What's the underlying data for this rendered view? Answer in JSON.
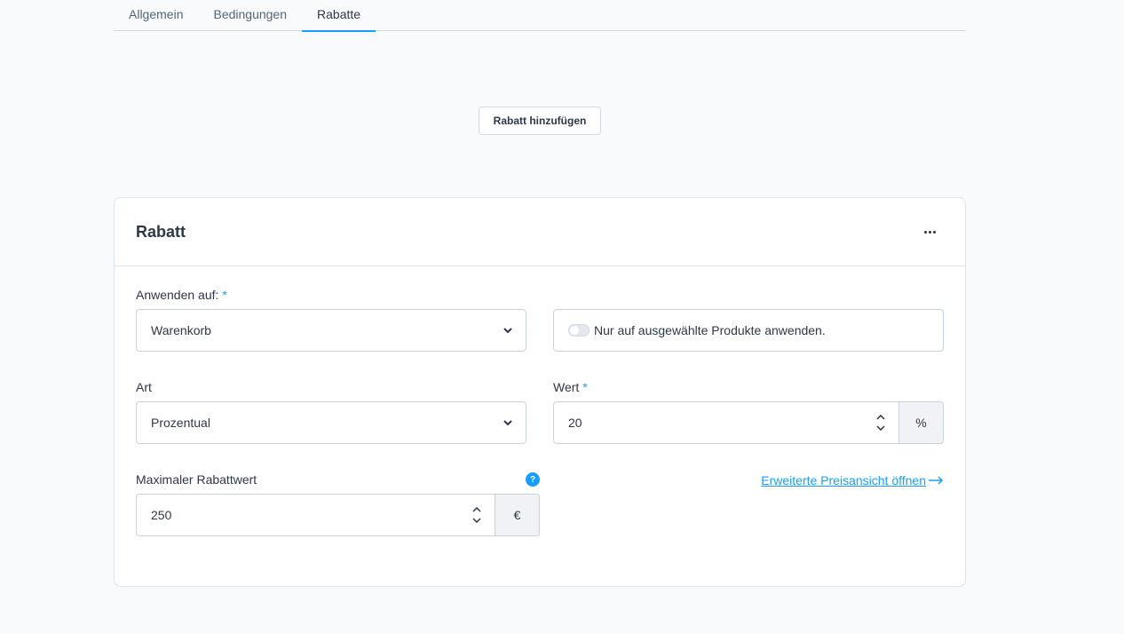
{
  "tabs": [
    {
      "label": "Allgemein",
      "active": false
    },
    {
      "label": "Bedingungen",
      "active": false
    },
    {
      "label": "Rabatte",
      "active": true
    }
  ],
  "add_button": "Rabatt hinzufügen",
  "card": {
    "title": "Rabatt",
    "apply_to": {
      "label": "Anwenden auf:",
      "required_mark": "*",
      "value": "Warenkorb"
    },
    "toggle": {
      "label": "Nur auf ausgewählte Produkte anwenden.",
      "checked": false
    },
    "type": {
      "label": "Art",
      "value": "Prozentual"
    },
    "value": {
      "label": "Wert",
      "required_mark": "*",
      "value": "20",
      "suffix": "%"
    },
    "max_value": {
      "label": "Maximaler Rabattwert",
      "value": "250",
      "suffix": "€",
      "help": "?"
    },
    "advanced_link": "Erweiterte Preisansicht öffnen"
  },
  "colors": {
    "accent": "#189eff",
    "text": "#2d3748",
    "border": "#c9d2db",
    "background": "#f9fafc"
  }
}
